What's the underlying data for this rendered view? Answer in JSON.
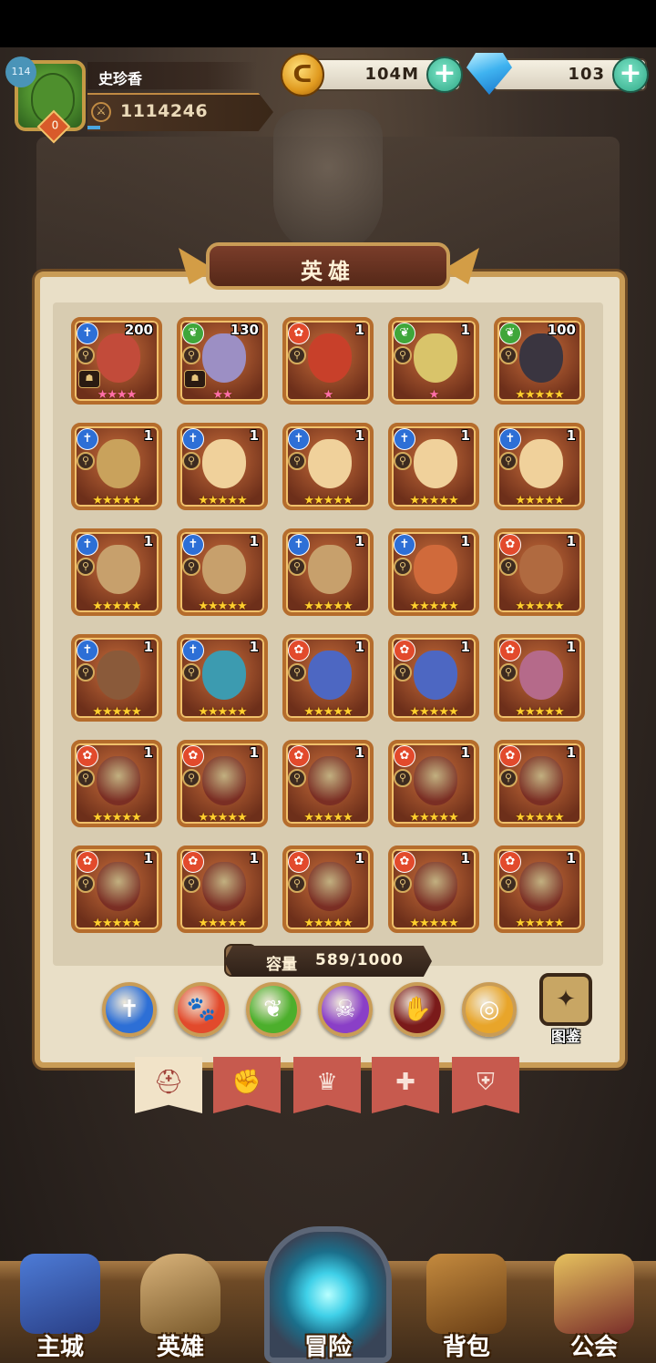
{
  "player": {
    "name": "史珍香",
    "vip": "114",
    "level": "0",
    "power": "1114246"
  },
  "resources": {
    "gold": "104M",
    "gems": "103",
    "plus": "+"
  },
  "panel": {
    "title": "英雄"
  },
  "heroes": [
    {
      "level": "200",
      "class": "holy",
      "stars": "★★★★",
      "pink": true,
      "team": true
    },
    {
      "level": "130",
      "class": "nature",
      "stars": "★★",
      "pink": true,
      "team": true
    },
    {
      "level": "1",
      "class": "beast",
      "stars": "★",
      "pink": true,
      "team": false
    },
    {
      "level": "1",
      "class": "nature",
      "stars": "★",
      "pink": true,
      "team": false
    },
    {
      "level": "100",
      "class": "nature",
      "stars": "★★★★★",
      "pink": false,
      "team": false
    },
    {
      "level": "1",
      "class": "holy",
      "stars": "★★★★★",
      "pink": false,
      "team": false
    },
    {
      "level": "1",
      "class": "holy",
      "stars": "★★★★★",
      "pink": false,
      "team": false
    },
    {
      "level": "1",
      "class": "holy",
      "stars": "★★★★★",
      "pink": false,
      "team": false
    },
    {
      "level": "1",
      "class": "holy",
      "stars": "★★★★★",
      "pink": false,
      "team": false
    },
    {
      "level": "1",
      "class": "holy",
      "stars": "★★★★★",
      "pink": false,
      "team": false
    },
    {
      "level": "1",
      "class": "holy",
      "stars": "★★★★★",
      "pink": false,
      "team": false
    },
    {
      "level": "1",
      "class": "holy",
      "stars": "★★★★★",
      "pink": false,
      "team": false
    },
    {
      "level": "1",
      "class": "holy",
      "stars": "★★★★★",
      "pink": false,
      "team": false
    },
    {
      "level": "1",
      "class": "holy",
      "stars": "★★★★★",
      "pink": false,
      "team": false
    },
    {
      "level": "1",
      "class": "beast",
      "stars": "★★★★★",
      "pink": false,
      "team": false
    },
    {
      "level": "1",
      "class": "holy",
      "stars": "★★★★★",
      "pink": false,
      "team": false
    },
    {
      "level": "1",
      "class": "holy",
      "stars": "★★★★★",
      "pink": false,
      "team": false
    },
    {
      "level": "1",
      "class": "beast",
      "stars": "★★★★★",
      "pink": false,
      "team": false
    },
    {
      "level": "1",
      "class": "beast",
      "stars": "★★★★★",
      "pink": false,
      "team": false
    },
    {
      "level": "1",
      "class": "beast",
      "stars": "★★★★★",
      "pink": false,
      "team": false
    },
    {
      "level": "1",
      "class": "beast",
      "stars": "★★★★★",
      "pink": false,
      "team": false
    },
    {
      "level": "1",
      "class": "beast",
      "stars": "★★★★★",
      "pink": false,
      "team": false
    },
    {
      "level": "1",
      "class": "beast",
      "stars": "★★★★★",
      "pink": false,
      "team": false
    },
    {
      "level": "1",
      "class": "beast",
      "stars": "★★★★★",
      "pink": false,
      "team": false
    },
    {
      "level": "1",
      "class": "beast",
      "stars": "★★★★★",
      "pink": false,
      "team": false
    },
    {
      "level": "1",
      "class": "beast",
      "stars": "★★★★★",
      "pink": false,
      "team": false
    },
    {
      "level": "1",
      "class": "beast",
      "stars": "★★★★★",
      "pink": false,
      "team": false
    },
    {
      "level": "1",
      "class": "beast",
      "stars": "★★★★★",
      "pink": false,
      "team": false
    },
    {
      "level": "1",
      "class": "beast",
      "stars": "★★★★★",
      "pink": false,
      "team": false
    },
    {
      "level": "1",
      "class": "beast",
      "stars": "★★★★★",
      "pink": false,
      "team": false
    }
  ],
  "capacity": {
    "label": "容量",
    "value": "589/1000"
  },
  "factions": [
    {
      "name": "holy-faction-icon",
      "color": "#2d6fd6",
      "glyph": "✝"
    },
    {
      "name": "beast-faction-icon",
      "color": "#e24a2c",
      "glyph": "🐾"
    },
    {
      "name": "nature-faction-icon",
      "color": "#4caf2c",
      "glyph": "❦"
    },
    {
      "name": "undead-faction-icon",
      "color": "#8a3fc7",
      "glyph": "☠"
    },
    {
      "name": "chaos-faction-icon",
      "color": "#7a1a1a",
      "glyph": "✋"
    },
    {
      "name": "light-faction-icon",
      "color": "#e8a52a",
      "glyph": "◎"
    }
  ],
  "codex": {
    "label": "图鉴"
  },
  "nav": [
    {
      "label": "主城"
    },
    {
      "label": "英雄"
    },
    {
      "label": "冒险"
    },
    {
      "label": "背包"
    },
    {
      "label": "公会"
    }
  ],
  "colors": {
    "holy": "#2d6fd6",
    "nature": "#3fa63a",
    "beast": "#e24a2c"
  }
}
